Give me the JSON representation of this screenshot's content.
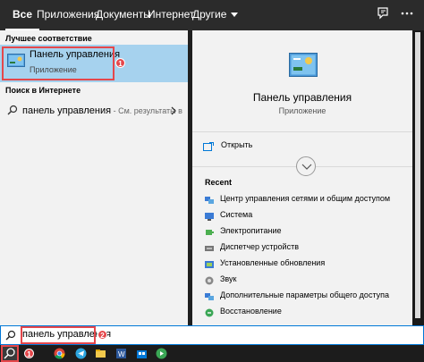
{
  "tabs": [
    {
      "label": "Все",
      "active": true
    },
    {
      "label": "Приложения",
      "active": false
    },
    {
      "label": "Документы",
      "active": false
    },
    {
      "label": "Интернет",
      "active": false
    },
    {
      "label": "Другие",
      "active": false
    }
  ],
  "top_icons": [
    "feedback-icon",
    "more-options-icon"
  ],
  "left": {
    "best_match_header": "Лучшее соответствие",
    "best_match": {
      "title": "Панель управления",
      "subtitle": "Приложение",
      "badge": "1"
    },
    "web_header": "Поиск в Интернете",
    "web_result": {
      "term": "панель управления",
      "hint": " - См. результаты в"
    }
  },
  "right": {
    "app_title": "Панель управления",
    "app_subtitle": "Приложение",
    "open_label": "Открыть",
    "recent_header": "Recent",
    "recent_items": [
      {
        "label": "Центр управления сетями и общим доступом",
        "icon": "network-icon"
      },
      {
        "label": "Система",
        "icon": "system-icon"
      },
      {
        "label": "Электропитание",
        "icon": "power-icon"
      },
      {
        "label": "Диспетчер устройств",
        "icon": "device-manager-icon"
      },
      {
        "label": "Установленные обновления",
        "icon": "updates-icon"
      },
      {
        "label": "Звук",
        "icon": "sound-icon"
      },
      {
        "label": "Дополнительные параметры общего доступа",
        "icon": "sharing-icon"
      },
      {
        "label": "Восстановление",
        "icon": "recovery-icon"
      }
    ]
  },
  "search": {
    "value": "панель управления",
    "badge": "2"
  },
  "taskbar": {
    "search_badge": "1",
    "apps": [
      "chrome-icon",
      "telegram-icon",
      "explorer-icon",
      "word-icon",
      "store-icon",
      "media-icon"
    ]
  },
  "colors": {
    "accent": "#0078d7",
    "highlight": "#a6d2ee",
    "annotation": "#e5474b"
  }
}
